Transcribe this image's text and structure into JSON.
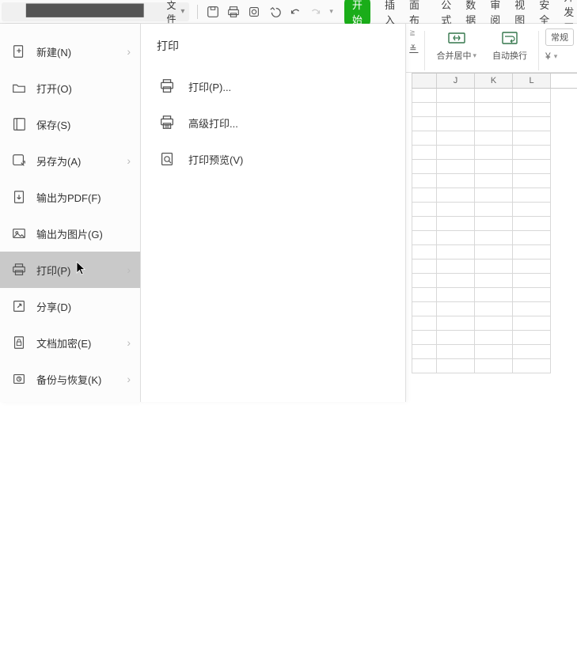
{
  "topbar": {
    "file_label": "文件",
    "tabs": {
      "start": "开始",
      "insert": "插入",
      "page_layout": "页面布局",
      "formula": "公式",
      "data": "数据",
      "review": "审阅",
      "view": "视图",
      "security": "安全",
      "dev": "开发工"
    }
  },
  "ribbon": {
    "merge_center": "合并居中",
    "auto_wrap": "自动换行",
    "style_general": "常规",
    "column_fragment": "≧"
  },
  "sheet": {
    "columns": [
      "",
      "J",
      "K",
      "L"
    ]
  },
  "file_menu": {
    "items": [
      {
        "key": "new",
        "label": "新建(N)",
        "arrow": true
      },
      {
        "key": "open",
        "label": "打开(O)",
        "arrow": false
      },
      {
        "key": "save",
        "label": "保存(S)",
        "arrow": false
      },
      {
        "key": "saveas",
        "label": "另存为(A)",
        "arrow": true
      },
      {
        "key": "exportpdf",
        "label": "输出为PDF(F)",
        "arrow": false
      },
      {
        "key": "exportimg",
        "label": "输出为图片(G)",
        "arrow": false
      },
      {
        "key": "print",
        "label": "打印(P)",
        "arrow": true,
        "active": true
      },
      {
        "key": "share",
        "label": "分享(D)",
        "arrow": false
      },
      {
        "key": "encrypt",
        "label": "文档加密(E)",
        "arrow": true
      },
      {
        "key": "backup",
        "label": "备份与恢复(K)",
        "arrow": true
      }
    ]
  },
  "print_submenu": {
    "title": "打印",
    "items": [
      {
        "key": "print",
        "label": "打印(P)..."
      },
      {
        "key": "advanced",
        "label": "高级打印..."
      },
      {
        "key": "preview",
        "label": "打印预览(V)"
      }
    ]
  }
}
